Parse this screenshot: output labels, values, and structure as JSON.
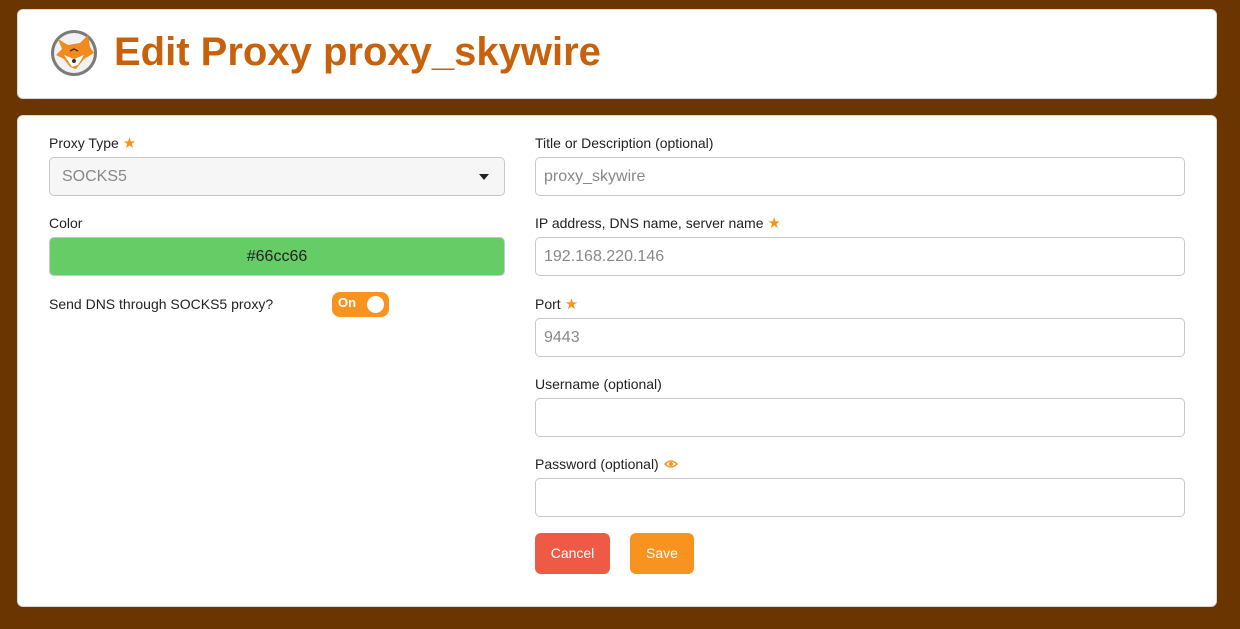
{
  "header": {
    "title": "Edit Proxy proxy_skywire",
    "logo_icon": "fox-logo-icon"
  },
  "form": {
    "proxy_type": {
      "label": "Proxy Type",
      "value": "SOCKS5",
      "required": true
    },
    "color": {
      "label": "Color",
      "value": "#66cc66"
    },
    "dns_toggle": {
      "label": "Send DNS through SOCKS5 proxy?",
      "state": "On"
    },
    "title": {
      "label": "Title or Description (optional)",
      "placeholder": "proxy_skywire"
    },
    "address": {
      "label": "IP address, DNS name, server name",
      "placeholder": "192.168.220.146",
      "required": true
    },
    "port": {
      "label": "Port",
      "placeholder": "9443",
      "required": true
    },
    "username": {
      "label": "Username (optional)",
      "placeholder": ""
    },
    "password": {
      "label": "Password (optional)",
      "placeholder": "",
      "icon": "eye-icon"
    }
  },
  "buttons": {
    "cancel": "Cancel",
    "save": "Save"
  },
  "colors": {
    "background": "#6b3500",
    "accent": "#f7931e",
    "title": "#c8610b",
    "cancel": "#ef5a46",
    "swatch": "#66cc66"
  }
}
